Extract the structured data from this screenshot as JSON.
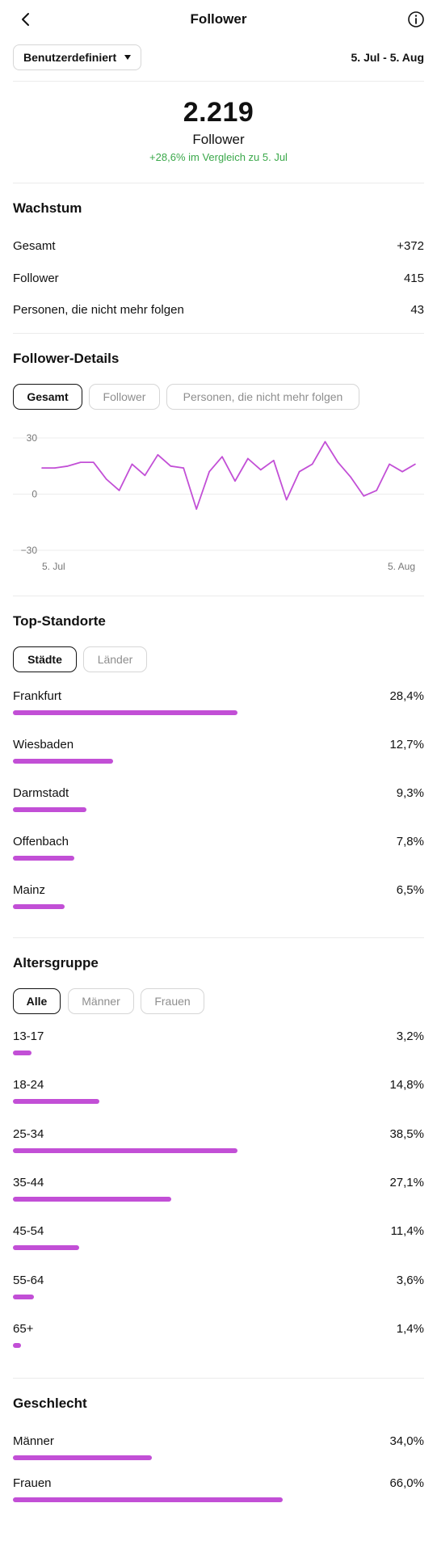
{
  "header": {
    "title": "Follower"
  },
  "range": {
    "selector_label": "Benutzerdefiniert",
    "dates": "5. Jul - 5. Aug"
  },
  "summary": {
    "total": "2.219",
    "label": "Follower",
    "comparison": "+28,6% im Vergleich zu 5. Jul"
  },
  "growth": {
    "title": "Wachstum",
    "rows": [
      {
        "label": "Gesamt",
        "value": "+372"
      },
      {
        "label": "Follower",
        "value": "415"
      },
      {
        "label": "Personen, die nicht mehr folgen",
        "value": "43"
      }
    ]
  },
  "details": {
    "title": "Follower-Details",
    "tabs": [
      "Gesamt",
      "Follower",
      "Personen, die nicht mehr folgen"
    ],
    "active_tab": 0
  },
  "chart_data": {
    "type": "line",
    "y_ticks": [
      "30",
      "0",
      "−30"
    ],
    "ylim": [
      -30,
      30
    ],
    "x_labels": [
      "5. Jul",
      "5. Aug"
    ],
    "grid": true,
    "color": "#c24fd6",
    "series": [
      {
        "values": [
          14,
          14,
          15,
          17,
          17,
          8,
          2,
          16,
          10,
          21,
          15,
          14,
          -8,
          12,
          20,
          7,
          19,
          13,
          18,
          -3,
          12,
          16,
          28,
          17,
          9,
          -1,
          2,
          16,
          12,
          16
        ]
      }
    ]
  },
  "locations": {
    "title": "Top-Standorte",
    "tabs": [
      "Städte",
      "Länder"
    ],
    "items": [
      {
        "label": "Frankfurt",
        "pct": "28,4%",
        "value": 28.4
      },
      {
        "label": "Wiesbaden",
        "pct": "12,7%",
        "value": 12.7
      },
      {
        "label": "Darmstadt",
        "pct": "9,3%",
        "value": 9.3
      },
      {
        "label": "Offenbach",
        "pct": "7,8%",
        "value": 7.8
      },
      {
        "label": "Mainz",
        "pct": "6,5%",
        "value": 6.5
      }
    ]
  },
  "age": {
    "title": "Altersgruppe",
    "tabs": [
      "Alle",
      "Männer",
      "Frauen"
    ],
    "items": [
      {
        "label": "13-17",
        "pct": "3,2%",
        "value": 3.2
      },
      {
        "label": "18-24",
        "pct": "14,8%",
        "value": 14.8
      },
      {
        "label": "25-34",
        "pct": "38,5%",
        "value": 38.5
      },
      {
        "label": "35-44",
        "pct": "27,1%",
        "value": 27.1
      },
      {
        "label": "45-54",
        "pct": "11,4%",
        "value": 11.4
      },
      {
        "label": "55-64",
        "pct": "3,6%",
        "value": 3.6
      },
      {
        "label": "65+",
        "pct": "1,4%",
        "value": 1.4
      }
    ]
  },
  "gender": {
    "title": "Geschlecht",
    "items": [
      {
        "label": "Männer",
        "pct": "34,0%",
        "value": 34.0
      },
      {
        "label": "Frauen",
        "pct": "66,0%",
        "value": 66.0
      }
    ]
  },
  "colors": {
    "accent": "#c24fd6",
    "positive": "#3aa84a"
  }
}
